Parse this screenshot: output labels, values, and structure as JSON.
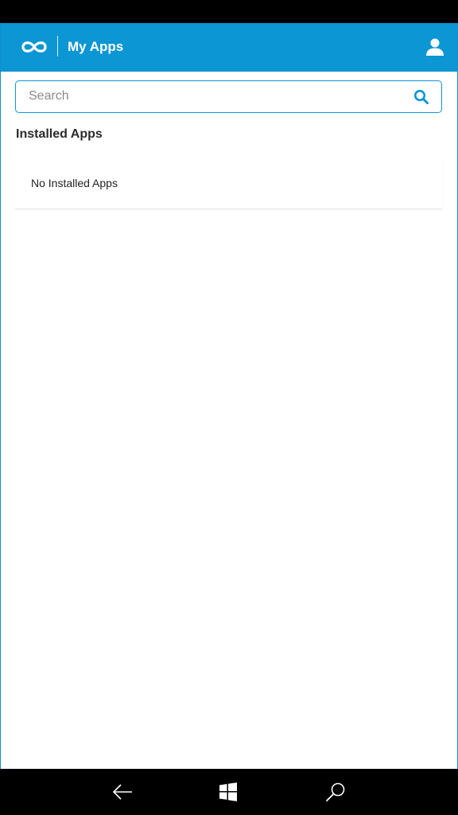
{
  "header": {
    "title": "My Apps",
    "brand_color": "#0c96d4"
  },
  "search": {
    "placeholder": "Search",
    "value": ""
  },
  "installed": {
    "section_title": "Installed Apps",
    "empty_message": "No Installed Apps"
  },
  "icons": {
    "logo": "infinity-logo-icon",
    "user": "user-icon",
    "search": "search-icon",
    "back": "back-arrow-icon",
    "home": "windows-icon",
    "nav_search": "search-icon"
  }
}
